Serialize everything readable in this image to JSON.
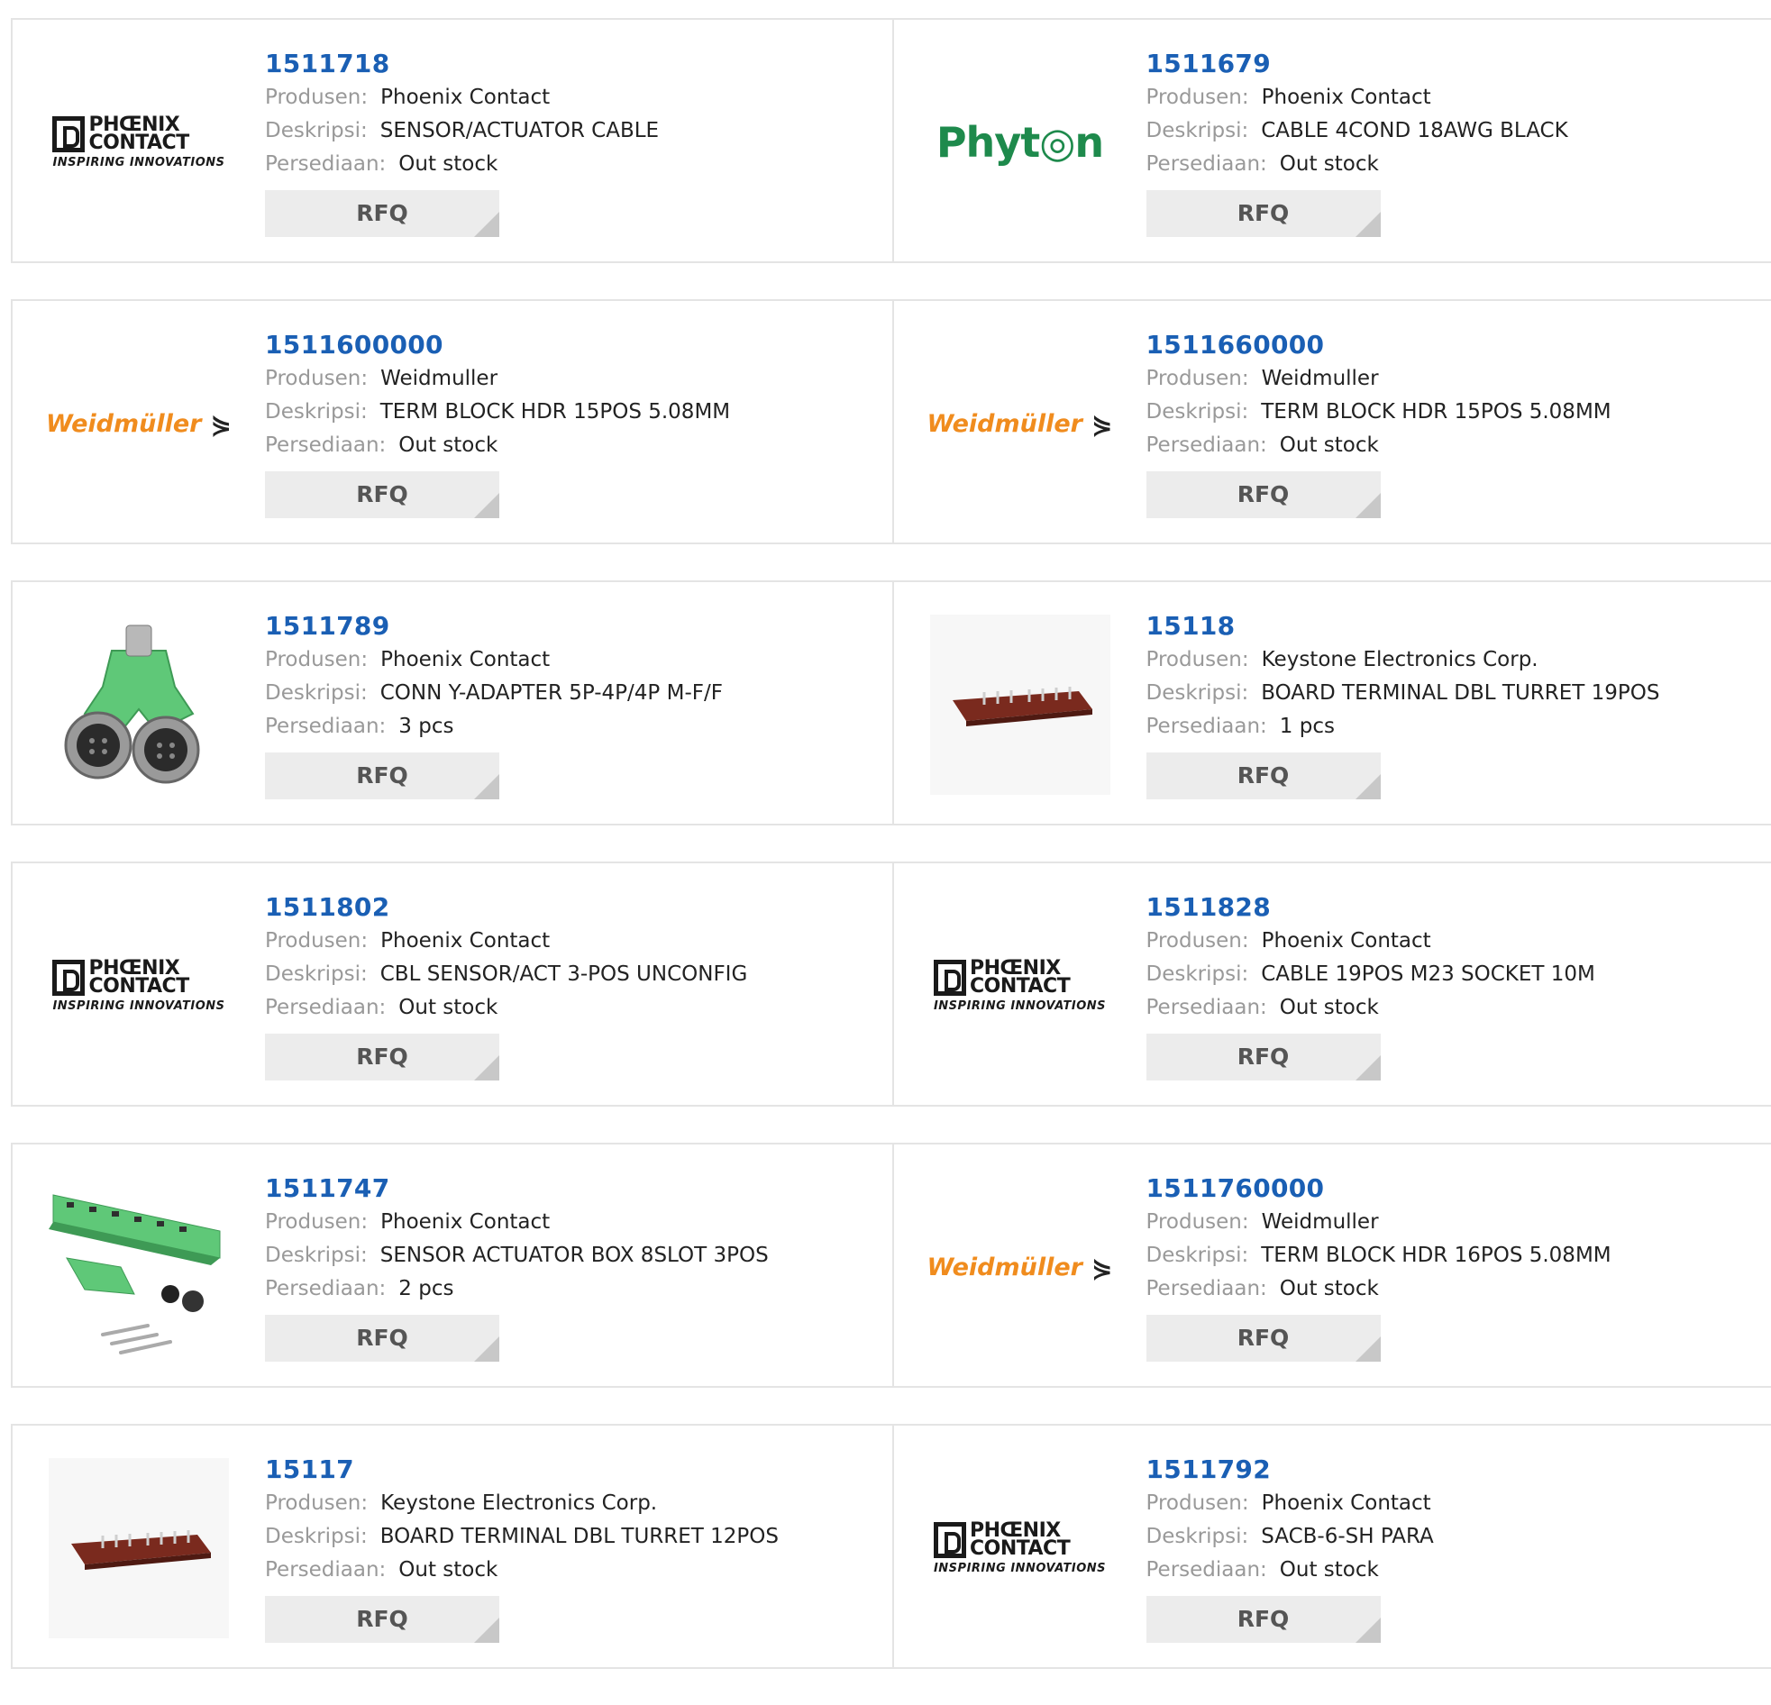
{
  "labels": {
    "manufacturer": "Produsen:",
    "description": "Deskripsi:",
    "stock": "Persediaan:",
    "rfq": "RFQ"
  },
  "products": [
    {
      "part": "1511718",
      "manufacturer": "Phoenix Contact",
      "description": "SENSOR/ACTUATOR CABLE",
      "stock": "Out stock",
      "logo": "phoenix-contact-logo"
    },
    {
      "part": "1511679",
      "manufacturer": "Phoenix Contact",
      "description": "CABLE 4COND 18AWG BLACK",
      "stock": "Out stock",
      "logo": "phyton-logo"
    },
    {
      "part": "1511600000",
      "manufacturer": "Weidmuller",
      "description": "TERM BLOCK HDR 15POS 5.08MM",
      "stock": "Out stock",
      "logo": "weidmuller-logo"
    },
    {
      "part": "1511660000",
      "manufacturer": "Weidmuller",
      "description": "TERM BLOCK HDR 15POS 5.08MM",
      "stock": "Out stock",
      "logo": "weidmuller-logo"
    },
    {
      "part": "1511789",
      "manufacturer": "Phoenix Contact",
      "description": "CONN Y-ADAPTER 5P-4P/4P M-F/F",
      "stock": "3 pcs",
      "logo": "y-adapter-photo"
    },
    {
      "part": "15118",
      "manufacturer": "Keystone Electronics Corp.",
      "description": "BOARD TERMINAL DBL TURRET 19POS",
      "stock": "1 pcs",
      "logo": "turret-board-photo"
    },
    {
      "part": "1511802",
      "manufacturer": "Phoenix Contact",
      "description": "CBL SENSOR/ACT 3-POS UNCONFIG",
      "stock": "Out stock",
      "logo": "phoenix-contact-logo"
    },
    {
      "part": "1511828",
      "manufacturer": "Phoenix Contact",
      "description": "CABLE 19POS M23 SOCKET 10M",
      "stock": "Out stock",
      "logo": "phoenix-contact-logo"
    },
    {
      "part": "1511747",
      "manufacturer": "Phoenix Contact",
      "description": "SENSOR ACTUATOR BOX 8SLOT 3POS",
      "stock": "2 pcs",
      "logo": "sensor-box-photo"
    },
    {
      "part": "1511760000",
      "manufacturer": "Weidmuller",
      "description": "TERM BLOCK HDR 16POS 5.08MM",
      "stock": "Out stock",
      "logo": "weidmuller-logo"
    },
    {
      "part": "15117",
      "manufacturer": "Keystone Electronics Corp.",
      "description": "BOARD TERMINAL DBL TURRET 12POS",
      "stock": "Out stock",
      "logo": "turret-board-photo"
    },
    {
      "part": "1511792",
      "manufacturer": "Phoenix Contact",
      "description": "SACB-6-SH PARA",
      "stock": "Out stock",
      "logo": "phoenix-contact-logo"
    }
  ],
  "logos": {
    "phoenix_words_1": "PHŒNIX",
    "phoenix_words_2": "CONTACT",
    "phoenix_tagline": "INSPIRING INNOVATIONS",
    "phyton": "Phyt◎n",
    "weidmuller": "Weidmüller",
    "weidmuller_symbol": "⋟"
  },
  "colors": {
    "link": "#1a5fb4",
    "label": "#999999",
    "rfq_bg": "#ececec",
    "weidmuller_orange": "#f08c1e",
    "phyton_green": "#1e8a4c",
    "product_green": "#5fc878"
  }
}
